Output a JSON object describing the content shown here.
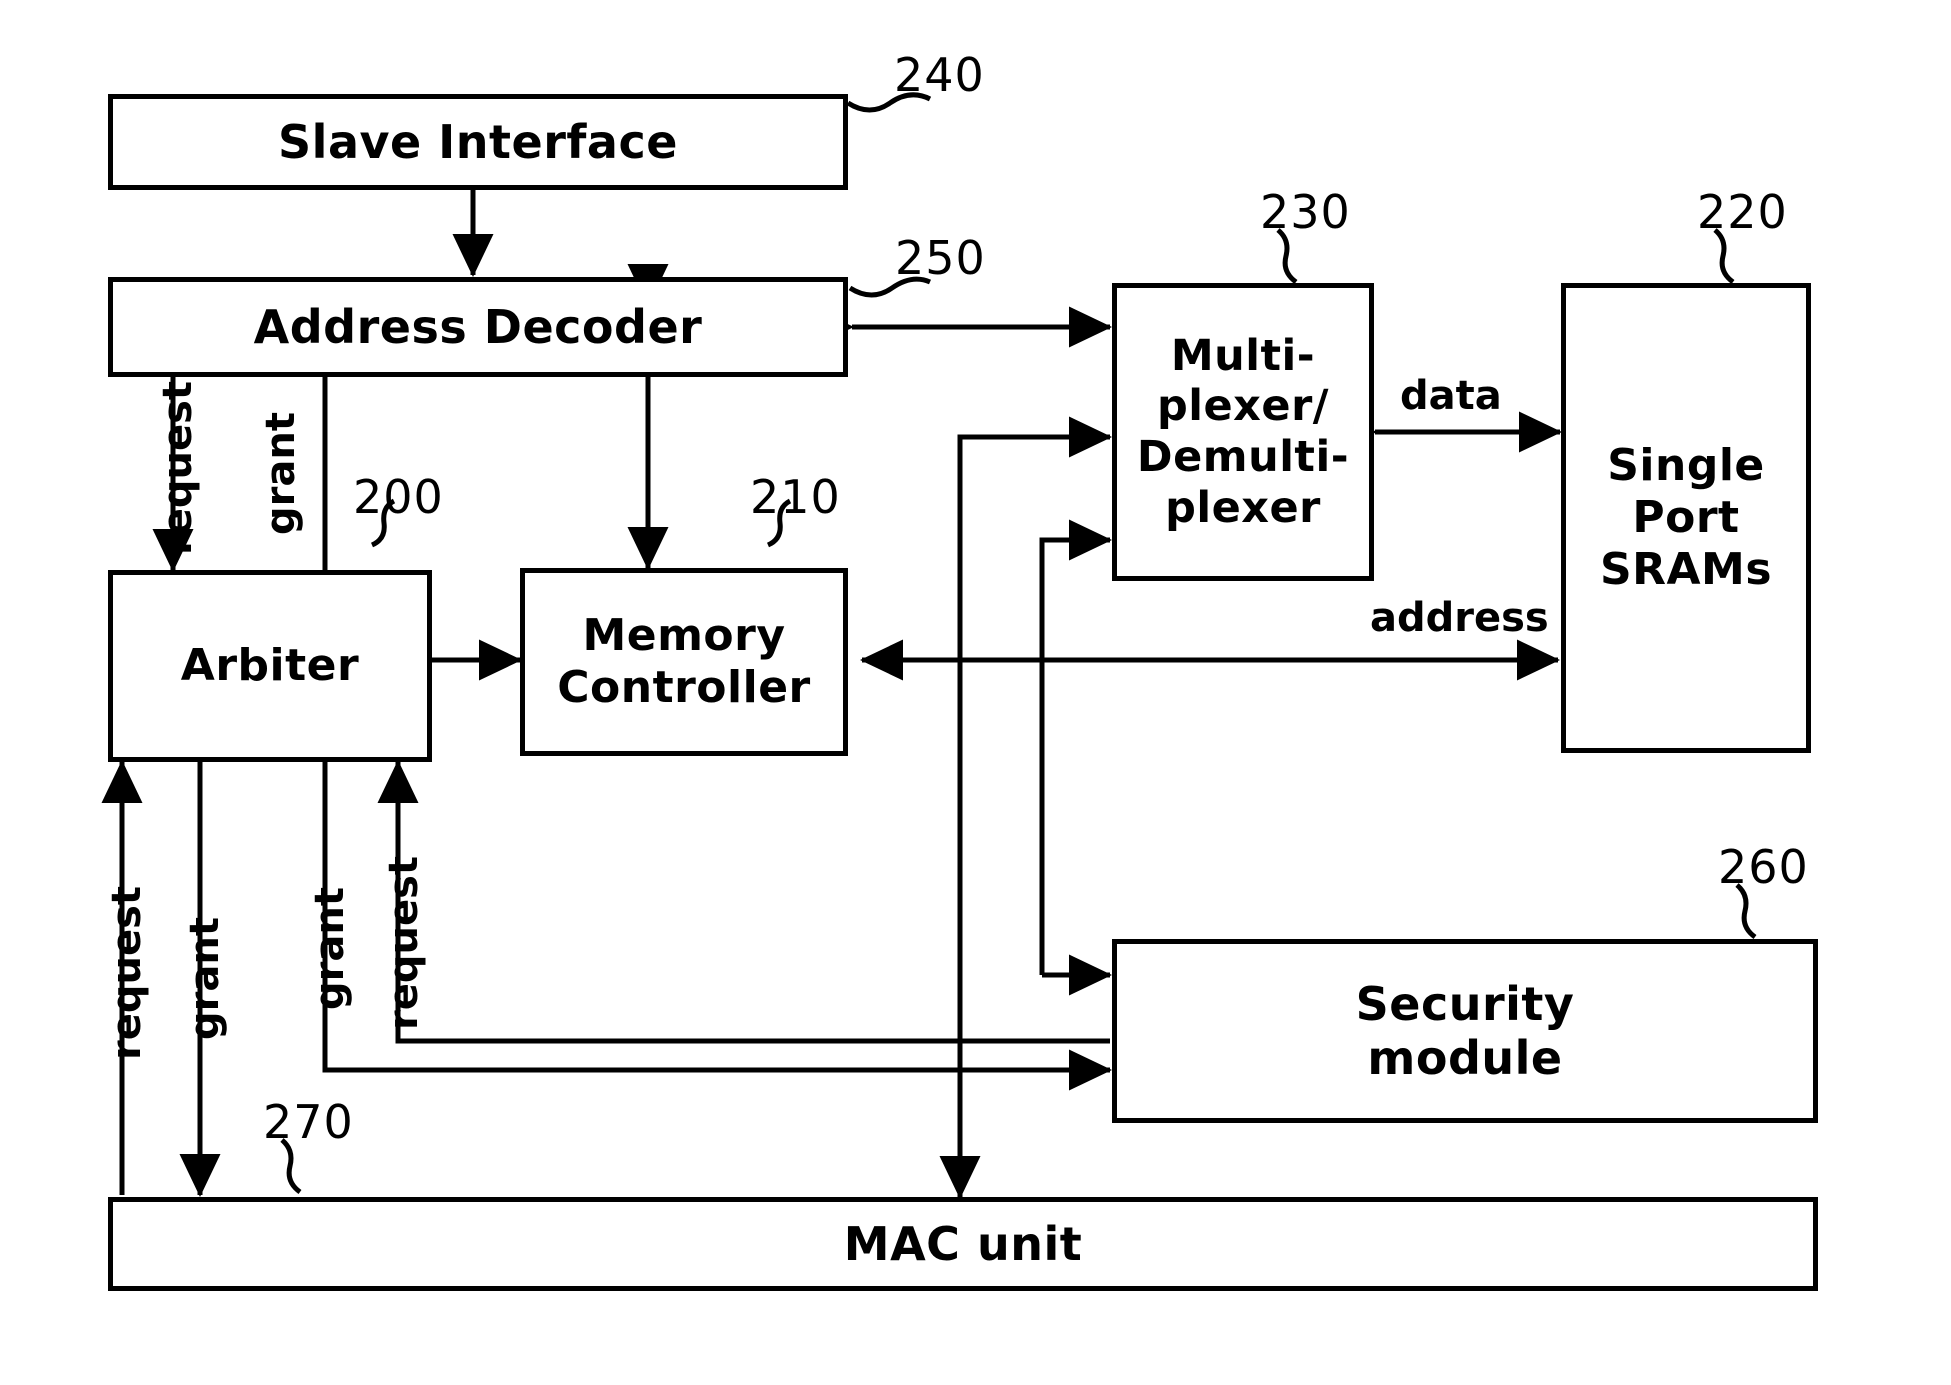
{
  "figure": {
    "type": "block-diagram",
    "title": "Memory system block diagram",
    "background": "#ffffff",
    "stroke": "#000000"
  },
  "blocks": [
    {
      "id": "slave_interface",
      "label": "Slave Interface",
      "ref": "240"
    },
    {
      "id": "address_decoder",
      "label": "Address Decoder",
      "ref": "250"
    },
    {
      "id": "arbiter",
      "label": "Arbiter",
      "ref": "200"
    },
    {
      "id": "memory_controller",
      "label": "Memory\nController",
      "ref": "210"
    },
    {
      "id": "mux_demux",
      "label": "Multi-\nplexer/\nDemulti-\nplexer",
      "ref": "230"
    },
    {
      "id": "sram",
      "label": "Single\nPort\nSRAMs",
      "ref": "220"
    },
    {
      "id": "security_module",
      "label": "Security\nmodule",
      "ref": "260"
    },
    {
      "id": "mac_unit",
      "label": "MAC unit",
      "ref": "270"
    }
  ],
  "signal_labels": {
    "request": "request",
    "grant": "grant",
    "data": "data",
    "address": "address"
  },
  "edge_labels": [
    {
      "id": "ad_arb_request",
      "text": "request"
    },
    {
      "id": "ad_arb_grant",
      "text": "grant"
    },
    {
      "id": "mac_arb_request",
      "text": "request"
    },
    {
      "id": "mac_arb_grant",
      "text": "grant"
    },
    {
      "id": "sec_arb_grant",
      "text": "grant"
    },
    {
      "id": "sec_arb_request",
      "text": "request"
    },
    {
      "id": "mux_sram_data",
      "text": "data"
    },
    {
      "id": "mc_sram_address",
      "text": "address"
    }
  ],
  "reference_numerals": [
    {
      "id": "ref_200",
      "value": "200",
      "target": "arbiter"
    },
    {
      "id": "ref_210",
      "value": "210",
      "target": "memory_controller"
    },
    {
      "id": "ref_220",
      "value": "220",
      "target": "sram"
    },
    {
      "id": "ref_230",
      "value": "230",
      "target": "mux_demux"
    },
    {
      "id": "ref_240",
      "value": "240",
      "target": "slave_interface"
    },
    {
      "id": "ref_250",
      "value": "250",
      "target": "address_decoder"
    },
    {
      "id": "ref_260",
      "value": "260",
      "target": "security_module"
    },
    {
      "id": "ref_270",
      "value": "270",
      "target": "mac_unit"
    }
  ]
}
